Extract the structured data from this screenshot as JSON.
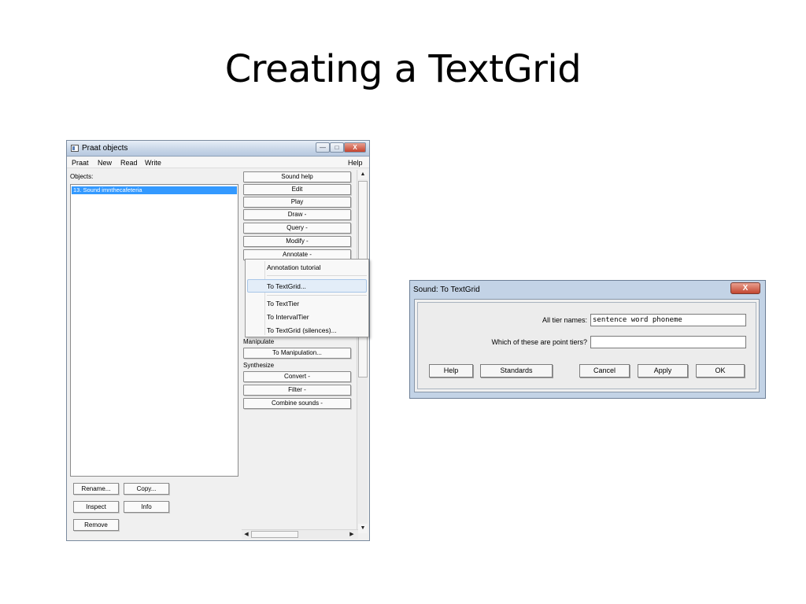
{
  "slide": {
    "title": "Creating a TextGrid"
  },
  "praat_window": {
    "title": "Praat objects",
    "titlebar_buttons": {
      "minimize": "—",
      "maximize": "□",
      "close": "X"
    },
    "menu": [
      "Praat",
      "New",
      "Read",
      "Write"
    ],
    "help": "Help",
    "objects_label": "Objects:",
    "selected_object": "13. Sound imnthecafeteria",
    "commands": [
      "Sound help",
      "Edit",
      "Play",
      "Draw -",
      "Query -",
      "Modify -",
      "Annotate -"
    ],
    "manipulate_label": "Manipulate",
    "manipulate_commands": [
      "To Manipulation..."
    ],
    "synthesize_label": "Synthesize",
    "synthesize_commands": [
      "Convert -",
      "Filter -",
      "Combine sounds -"
    ],
    "bottom_buttons": [
      "Rename...",
      "Copy...",
      "Inspect",
      "Info",
      "Remove"
    ]
  },
  "annotate_menu": {
    "items": [
      "Annotation tutorial",
      "To TextGrid...",
      "To TextTier",
      "To IntervalTier",
      "To TextGrid (silences)..."
    ],
    "highlighted": "To TextGrid..."
  },
  "dialog": {
    "title": "Sound: To TextGrid",
    "close": "X",
    "fields": [
      {
        "label": "All tier names:",
        "value": "sentence word phoneme"
      },
      {
        "label": "Which of these are point tiers?",
        "value": ""
      }
    ],
    "buttons": [
      "Help",
      "Standards",
      "Cancel",
      "Apply",
      "OK"
    ]
  }
}
